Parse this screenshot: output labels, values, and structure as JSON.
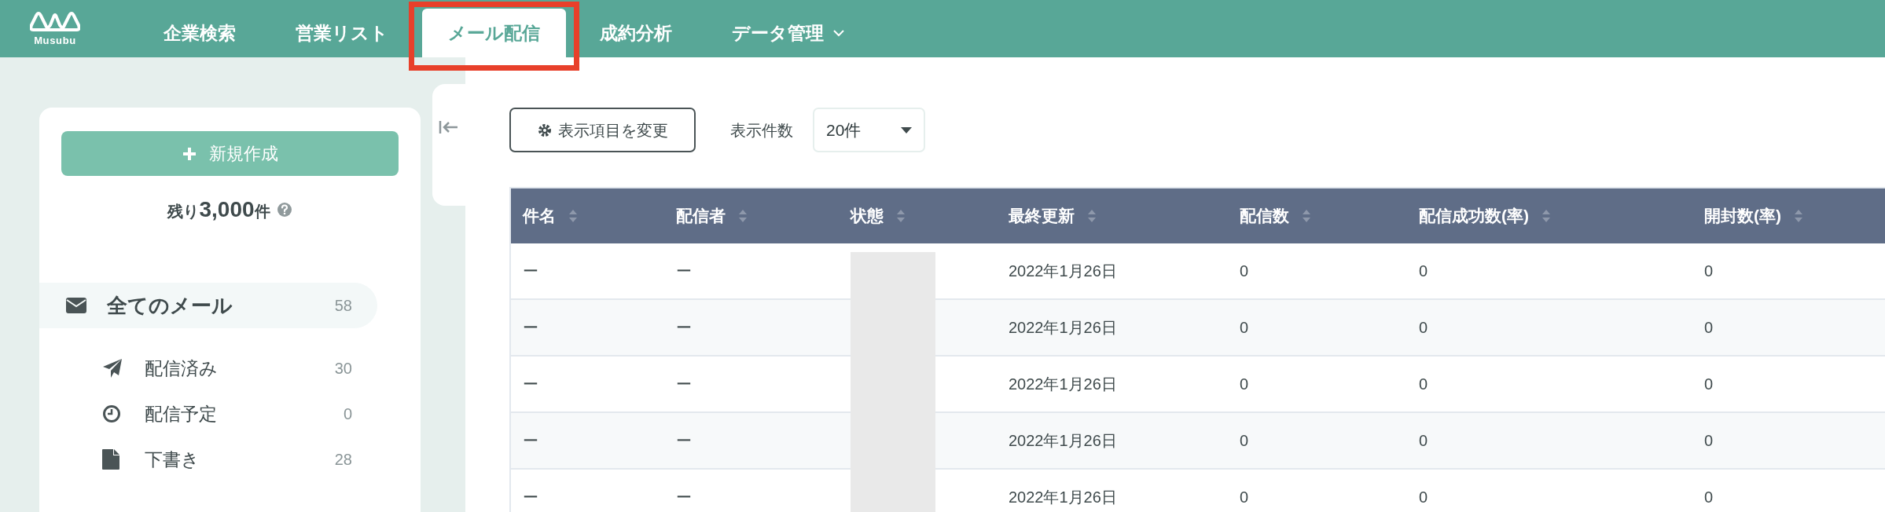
{
  "logo": {
    "text": "Musubu"
  },
  "nav": [
    {
      "label": "企業検索",
      "selected": false,
      "highlighted": false,
      "dropdown": false
    },
    {
      "label": "営業リスト",
      "selected": false,
      "highlighted": false,
      "dropdown": false
    },
    {
      "label": "メール配信",
      "selected": true,
      "highlighted": true,
      "dropdown": false
    },
    {
      "label": "成約分析",
      "selected": false,
      "highlighted": false,
      "dropdown": false
    },
    {
      "label": "データ管理",
      "selected": false,
      "highlighted": false,
      "dropdown": true
    }
  ],
  "sidebar": {
    "new_button": "新規作成",
    "remaining_prefix": "残り",
    "remaining_count": "3,000",
    "remaining_suffix": "件",
    "folders": [
      {
        "kind": "mail",
        "label": "全てのメール",
        "count": "58",
        "selected": true,
        "children": [
          {
            "kind": "sent",
            "label": "配信済み",
            "count": "30",
            "selected": false
          },
          {
            "kind": "scheduled",
            "label": "配信予定",
            "count": "0",
            "selected": false
          },
          {
            "kind": "draft",
            "label": "下書き",
            "count": "28",
            "selected": false
          }
        ]
      }
    ]
  },
  "toolbar": {
    "columns_button": "表示項目を変更",
    "page_size_label": "表示件数",
    "page_size_value": "20件"
  },
  "table": {
    "columns": [
      "件名",
      "配信者",
      "状態",
      "最終更新",
      "配信数",
      "配信成功数(率)",
      "開封数(率)"
    ],
    "rows": [
      {
        "subject": "ー",
        "sender": "ー",
        "status_hidden": true,
        "updated": "2022年1月26日",
        "sent": "0",
        "success": "0",
        "opened": "0"
      },
      {
        "subject": "ー",
        "sender": "ー",
        "status_hidden": true,
        "updated": "2022年1月26日",
        "sent": "0",
        "success": "0",
        "opened": "0"
      },
      {
        "subject": "ー",
        "sender": "ー",
        "status_hidden": true,
        "updated": "2022年1月26日",
        "sent": "0",
        "success": "0",
        "opened": "0"
      },
      {
        "subject": "ー",
        "sender": "ー",
        "status_hidden": true,
        "updated": "2022年1月26日",
        "sent": "0",
        "success": "0",
        "opened": "0"
      },
      {
        "subject": "ー",
        "sender": "ー",
        "status_hidden": true,
        "updated": "2022年1月26日",
        "sent": "0",
        "success": "0",
        "opened": "0"
      }
    ]
  }
}
